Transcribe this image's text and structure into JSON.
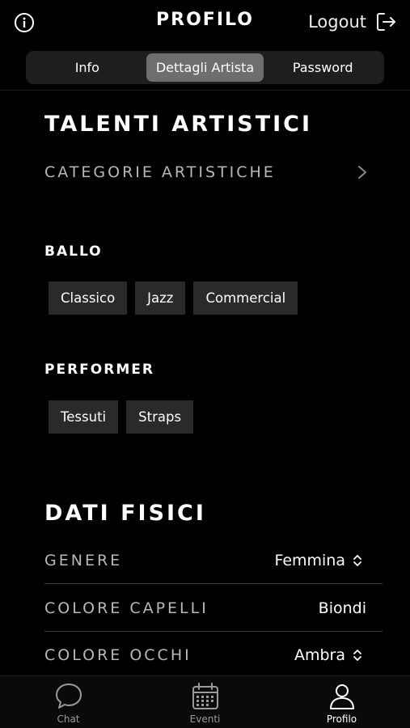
{
  "header": {
    "title": "PROFILO",
    "logout_label": "Logout"
  },
  "segments": [
    {
      "label": "Info",
      "active": false
    },
    {
      "label": "Dettagli Artista",
      "active": true
    },
    {
      "label": "Password",
      "active": false
    }
  ],
  "talents": {
    "title": "TALENTI ARTISTICI",
    "categories_label": "CATEGORIE ARTISTICHE",
    "groups": [
      {
        "name": "BALLO",
        "chips": [
          "Classico",
          "Jazz",
          "Commercial"
        ]
      },
      {
        "name": "PERFORMER",
        "chips": [
          "Tessuti",
          "Straps"
        ]
      }
    ]
  },
  "physical": {
    "title": "DATI FISICI",
    "fields": [
      {
        "label": "GENERE",
        "value": "Femmina"
      },
      {
        "label": "COLORE CAPELLI",
        "value": "Biondi"
      },
      {
        "label": "COLORE OCCHI",
        "value": "Ambra"
      }
    ]
  },
  "tabbar": {
    "items": [
      {
        "label": "Chat",
        "icon": "chat-bubble-icon"
      },
      {
        "label": "Eventi",
        "icon": "calendar-icon"
      },
      {
        "label": "Profilo",
        "icon": "person-icon"
      }
    ]
  },
  "colors": {
    "background": "#000000",
    "active_segment": "#6e6e6e",
    "chip_bg": "#2a2a2a",
    "muted_label": "#b8b8b8"
  }
}
